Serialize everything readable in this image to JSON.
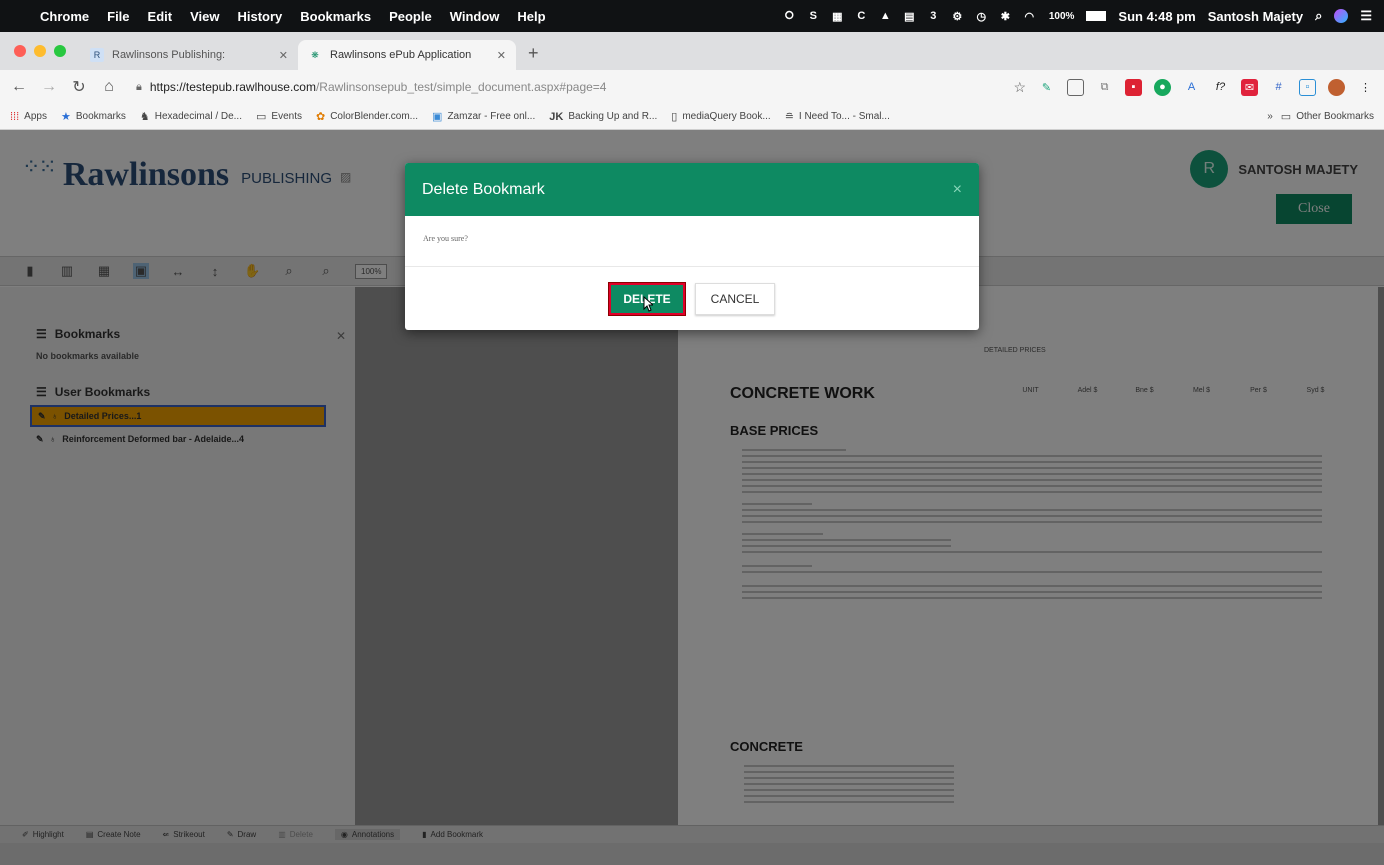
{
  "menubar": {
    "apple": "",
    "items": [
      "Chrome",
      "File",
      "Edit",
      "View",
      "History",
      "Bookmarks",
      "People",
      "Window",
      "Help"
    ],
    "battery": "100%",
    "clock": "Sun 4:48 pm",
    "user": "Santosh Majety"
  },
  "tabs": [
    {
      "label": "Rawlinsons Publishing:",
      "favicon": "R"
    },
    {
      "label": "Rawlinsons ePub Application",
      "favicon": "❋"
    }
  ],
  "address": {
    "host": "https://testepub.rawlhouse.com",
    "path": "/Rawlinsonsepub_test/simple_document.aspx#page=4"
  },
  "bookmarks_bar": {
    "items": [
      "Apps",
      "Bookmarks",
      "Hexadecimal / De...",
      "Events",
      "ColorBlender.com...",
      "Zamzar - Free onl...",
      "Backing Up and R...",
      "mediaQuery Book...",
      "I Need To... - Smal..."
    ],
    "other": "Other Bookmarks",
    "more": "»"
  },
  "app": {
    "brand": "Rawlinsons",
    "brand_suffix": "PUBLISHING",
    "user_initial": "R",
    "user_name": "SANTOSH MAJETY",
    "close_label": "Close",
    "zoom": "100%"
  },
  "sidebar": {
    "bookmarks_title": "Bookmarks",
    "empty_text": "No bookmarks available",
    "user_bookmarks_title": "User Bookmarks",
    "items": [
      "Detailed Prices...1",
      "Reinforcement Deformed bar - Adelaide...4"
    ]
  },
  "document": {
    "header": "DETAILED PRICES",
    "heading1": "CONCRETE WORK",
    "heading2": "BASE PRICES",
    "heading3": "CONCRETE",
    "unit_label": "UNIT",
    "columns": [
      "Adel $",
      "Bne $",
      "Mel $",
      "Per $",
      "Syd $"
    ]
  },
  "bottom_toolbar": [
    "Highlight",
    "Create Note",
    "Strikeout",
    "Draw",
    "Delete",
    "Annotations",
    "Add Bookmark"
  ],
  "modal": {
    "title": "Delete Bookmark",
    "close_glyph": "×",
    "message": "Are you sure?",
    "delete_label": "DELETE",
    "cancel_label": "CANCEL"
  }
}
